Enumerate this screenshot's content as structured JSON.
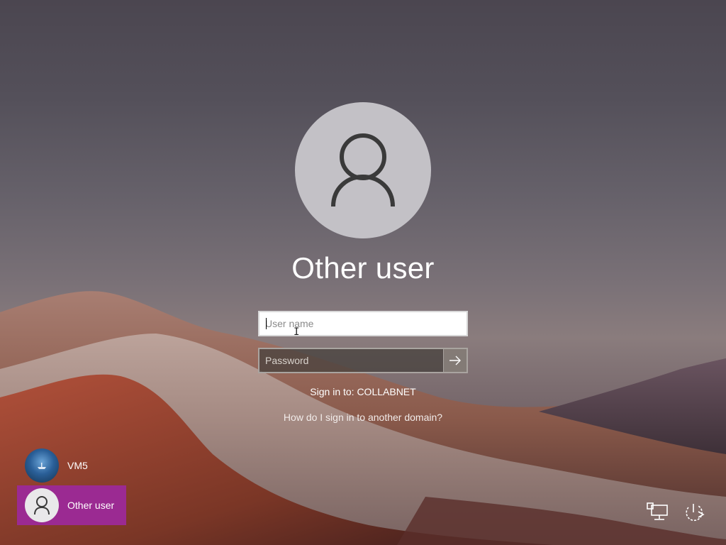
{
  "login": {
    "display_name": "Other user",
    "username_placeholder": "User name",
    "password_placeholder": "Password",
    "sign_in_to": "Sign in to: COLLABNET",
    "domain_help_link": "How do I sign in to another domain?"
  },
  "user_list": {
    "items": [
      {
        "label": "VM5",
        "icon": "vm5-avatar-icon",
        "active": false
      },
      {
        "label": "Other user",
        "icon": "person-icon",
        "active": true
      }
    ]
  },
  "corner_buttons": {
    "network": {
      "icon": "network-icon"
    },
    "power": {
      "icon": "power-icon"
    }
  },
  "colors": {
    "selected_user_bg": "#9b2a92",
    "avatar_bg": "#c3c1c6"
  }
}
